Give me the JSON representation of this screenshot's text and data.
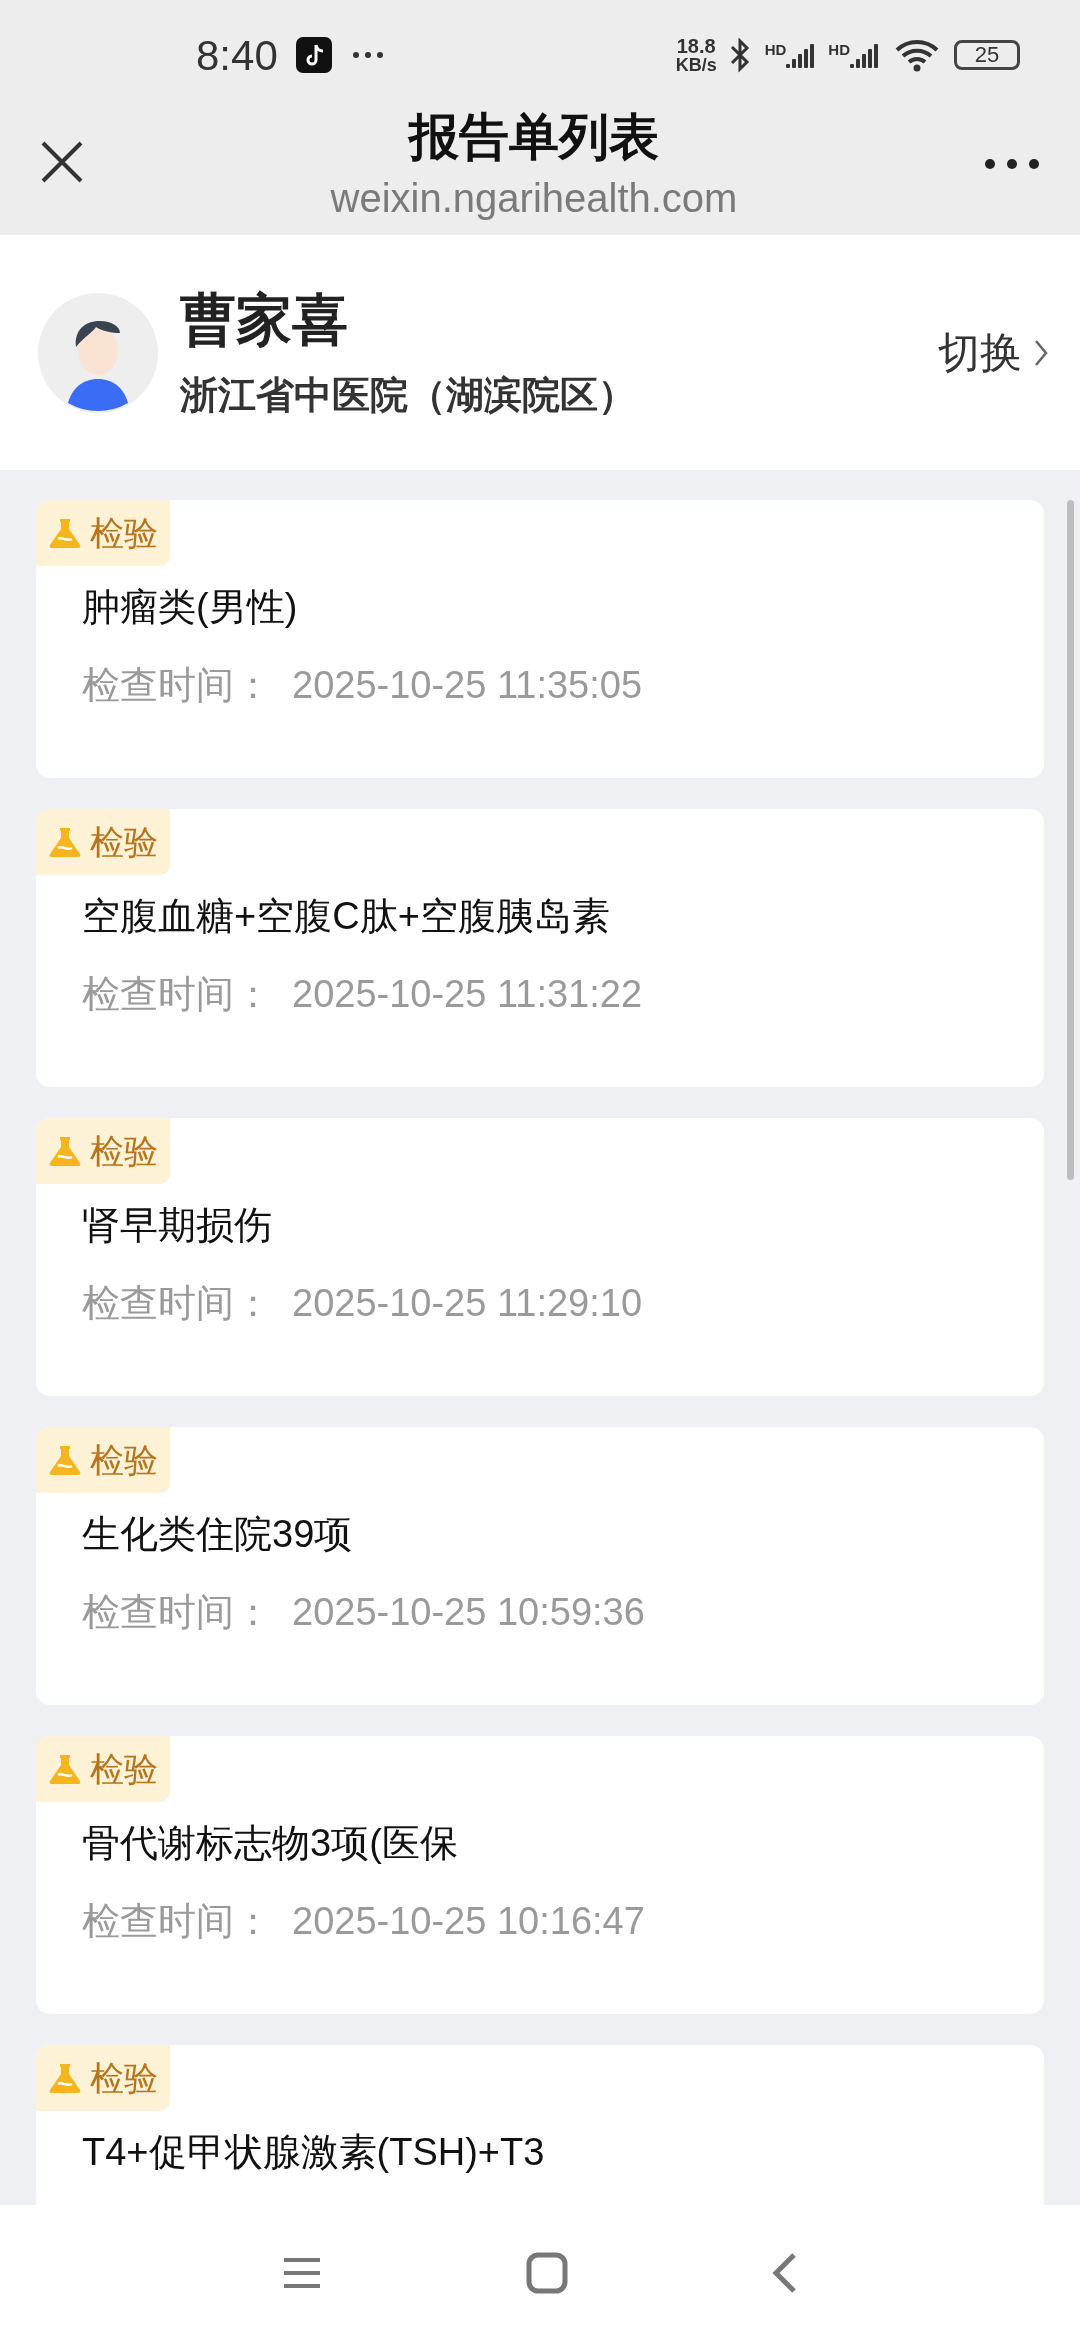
{
  "status_bar": {
    "time": "8:40",
    "speed_value": "18.8",
    "speed_unit": "KB/s",
    "sim_labels": [
      "HD",
      "HD"
    ],
    "battery": "25"
  },
  "header": {
    "title": "报告单列表",
    "url": "weixin.ngarihealth.com"
  },
  "profile": {
    "name": "曹家喜",
    "hospital": "浙江省中医院（湖滨院区）",
    "switch_label": "切换"
  },
  "reports": [
    {
      "category": "检验",
      "name": "肿瘤类(男性)",
      "time_label": "检查时间：",
      "time": "2025-10-25 11:35:05"
    },
    {
      "category": "检验",
      "name": "空腹血糖+空腹C肽+空腹胰岛素",
      "time_label": "检查时间：",
      "time": "2025-10-25 11:31:22"
    },
    {
      "category": "检验",
      "name": "肾早期损伤",
      "time_label": "检查时间：",
      "time": "2025-10-25 11:29:10"
    },
    {
      "category": "检验",
      "name": "生化类住院39项",
      "time_label": "检查时间：",
      "time": "2025-10-25 10:59:36"
    },
    {
      "category": "检验",
      "name": "骨代谢标志物3项(医保",
      "time_label": "检查时间：",
      "time": "2025-10-25 10:16:47"
    },
    {
      "category": "检验",
      "name": "T4+促甲状腺激素(TSH)+T3"
    }
  ]
}
